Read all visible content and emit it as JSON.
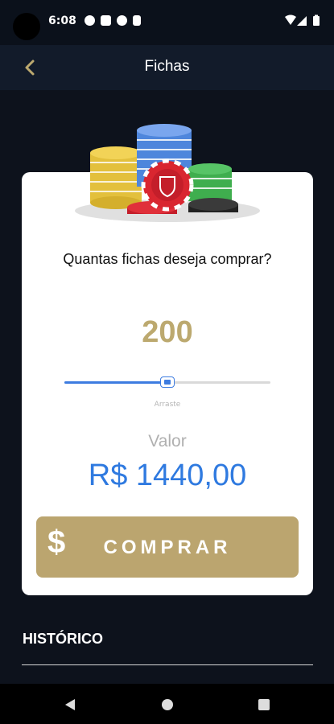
{
  "status_bar": {
    "time": "6:08"
  },
  "app_bar": {
    "title": "Fichas",
    "back_icon": "chevron-left-icon"
  },
  "purchase": {
    "question": "Quantas fichas deseja comprar?",
    "amount": "200",
    "slider_fraction": 0.5,
    "slider_hint": "Arraste",
    "value_label": "Valor",
    "value": "R$ 1440,00",
    "buy_icon": "dollar-icon",
    "buy_icon_glyph": "$",
    "buy_label": "COMPRAR"
  },
  "history": {
    "title": "HISTÓRICO"
  },
  "nav_bar": {
    "items": [
      "back-icon",
      "home-icon",
      "recents-icon"
    ]
  },
  "colors": {
    "background": "#0d121c",
    "app_bar": "#121b2a",
    "gold": "#bca96f",
    "blue": "#2f7ae0",
    "slider": "#3d7ce0"
  }
}
